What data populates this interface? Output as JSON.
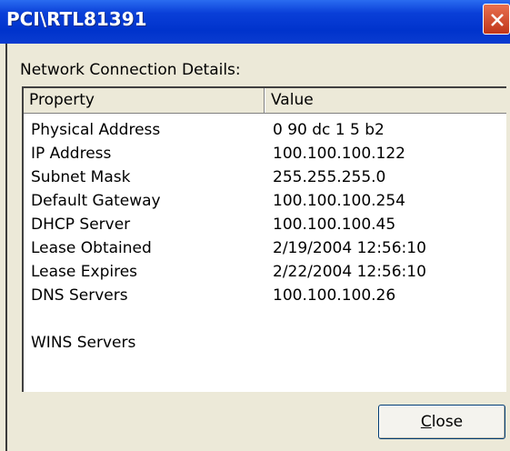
{
  "window": {
    "title": "PCI\\RTL81391"
  },
  "dialog": {
    "section_label": "Network Connection Details:",
    "columns": [
      "Property",
      "Value"
    ],
    "rows": [
      {
        "property": "Physical Address",
        "value": "0 90 dc 1 5 b2"
      },
      {
        "property": "IP Address",
        "value": "100.100.100.122"
      },
      {
        "property": "Subnet Mask",
        "value": "255.255.255.0"
      },
      {
        "property": "Default Gateway",
        "value": "100.100.100.254"
      },
      {
        "property": "DHCP Server",
        "value": "100.100.100.45"
      },
      {
        "property": "Lease Obtained",
        "value": "2/19/2004 12:56:10"
      },
      {
        "property": "Lease Expires",
        "value": "2/22/2004 12:56:10"
      },
      {
        "property": "DNS Servers",
        "value": "100.100.100.26"
      },
      {
        "property": "",
        "value": ""
      },
      {
        "property": "WINS Servers",
        "value": ""
      }
    ],
    "close_button": {
      "mnemonic": "C",
      "rest": "lose"
    }
  },
  "colors": {
    "titlebar": "#0033cc",
    "close_x": "#c0361a",
    "dialog_bg": "#ece9d8"
  },
  "icons": {
    "close": "close-icon"
  }
}
